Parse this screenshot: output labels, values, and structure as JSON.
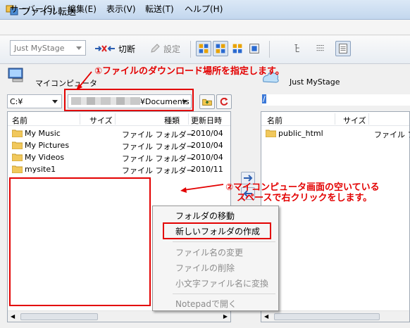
{
  "window": {
    "title": "ファイル転送"
  },
  "menu": [
    "サーバー(S)",
    "編集(E)",
    "表示(V)",
    "転送(T)",
    "ヘルプ(H)"
  ],
  "toolbar": {
    "site_select": "Just MyStage",
    "disconnect_label": "切断",
    "settings_label": "設定"
  },
  "left": {
    "label": "マイコンピュータ",
    "drive": "C:¥",
    "path_suffix": "¥Documents",
    "columns": [
      "名前",
      "サイズ",
      "種類",
      "更新日時"
    ],
    "rows": [
      {
        "name": "My Music",
        "size": "",
        "type": "ファイル フォルダー",
        "date": "2010/04"
      },
      {
        "name": "My Pictures",
        "size": "",
        "type": "ファイル フォルダー",
        "date": "2010/04"
      },
      {
        "name": "My Videos",
        "size": "",
        "type": "ファイル フォルダー",
        "date": "2010/04"
      },
      {
        "name": "mysite1",
        "size": "",
        "type": "ファイル フォルダー",
        "date": "2010/11"
      }
    ]
  },
  "right": {
    "label": "Just MyStage",
    "path": "/",
    "columns": [
      "名前",
      "サイズ"
    ],
    "rows": [
      {
        "name": "public_html",
        "type": "ファイル フ"
      }
    ]
  },
  "context_menu": {
    "items": [
      {
        "label": "フォルダの移動",
        "enabled": true
      },
      {
        "label": "新しいフォルダの作成",
        "enabled": true
      },
      {
        "label": "ファイル名の変更",
        "enabled": false
      },
      {
        "label": "ファイルの削除",
        "enabled": false
      },
      {
        "label": "小文字ファイル名に変換",
        "enabled": false
      },
      {
        "label": "Notepadで開く",
        "enabled": false
      }
    ]
  },
  "annotations": {
    "step1": "①ファイルのダウンロード場所を指定します。",
    "step2_line1": "②マイコンピュータ画面の空いている",
    "step2_line2": "スペースで右クリックをします。"
  },
  "colors": {
    "annotation": "#e30000",
    "folder": "#f1c85c",
    "selection": "#3a78d8"
  }
}
